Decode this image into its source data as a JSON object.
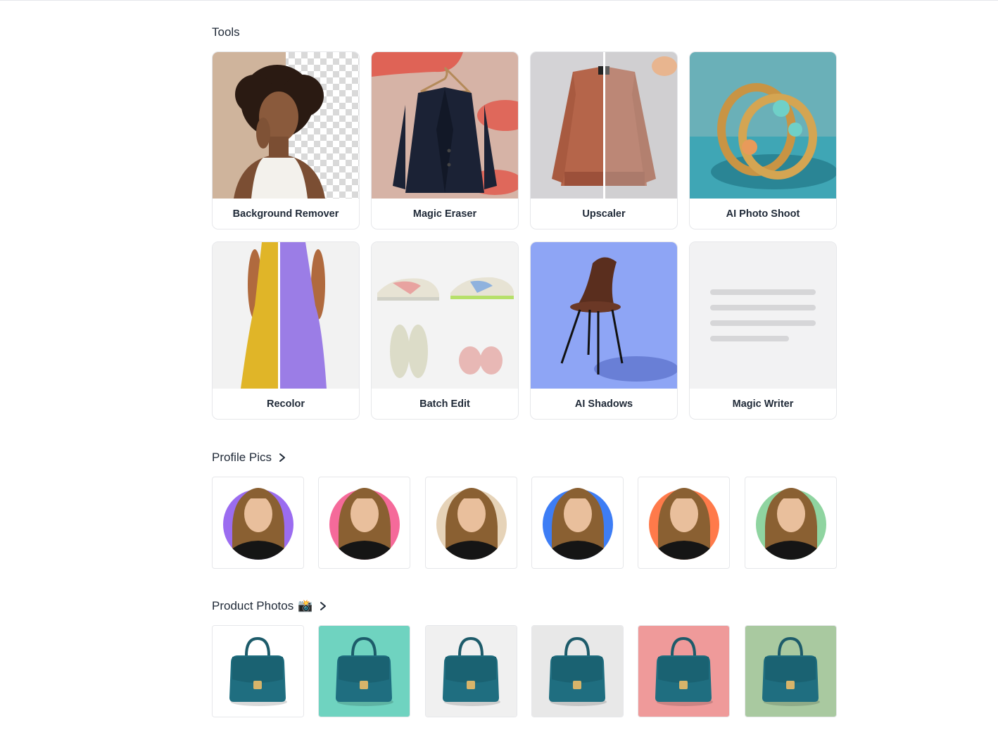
{
  "sections": {
    "tools": {
      "title": "Tools"
    },
    "profile_pics": {
      "title": "Profile Pics",
      "chevron_icon": "chevron-right-icon"
    },
    "product_photos": {
      "title": "Product Photos",
      "emoji": "📸",
      "chevron_icon": "chevron-right-icon"
    }
  },
  "tools": [
    {
      "label": "Background Remover",
      "icon": "background-remover-thumbnail"
    },
    {
      "label": "Magic Eraser",
      "icon": "magic-eraser-thumbnail"
    },
    {
      "label": "Upscaler",
      "icon": "upscaler-thumbnail"
    },
    {
      "label": "AI Photo Shoot",
      "icon": "ai-photo-shoot-thumbnail"
    },
    {
      "label": "Recolor",
      "icon": "recolor-thumbnail"
    },
    {
      "label": "Batch Edit",
      "icon": "batch-edit-thumbnail"
    },
    {
      "label": "AI Shadows",
      "icon": "ai-shadows-thumbnail"
    },
    {
      "label": "Magic Writer",
      "icon": "magic-writer-thumbnail"
    }
  ],
  "profile_pic_backgrounds": [
    "#9b6cf0",
    "#f56a9a",
    "#e6d3b8",
    "#3d7df5",
    "#ff7a4a",
    "#8fd4a0"
  ],
  "product_photo_backgrounds": [
    "#ffffff",
    "#6fd3c0",
    "#f0f0f0",
    "#e8e8e8",
    "#ef9a9a",
    "#a9c9a0"
  ]
}
